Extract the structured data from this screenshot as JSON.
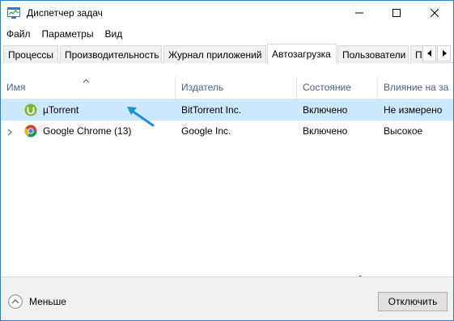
{
  "window": {
    "title": "Диспетчер задач",
    "accent_color": "#1883d7"
  },
  "menu": [
    "Файл",
    "Параметры",
    "Вид"
  ],
  "tabs": [
    {
      "label": "Процессы",
      "active": false
    },
    {
      "label": "Производительность",
      "active": false
    },
    {
      "label": "Журнал приложений",
      "active": false
    },
    {
      "label": "Автозагрузка",
      "active": true
    },
    {
      "label": "Пользователи",
      "active": false
    },
    {
      "label": "По",
      "active": false
    }
  ],
  "table": {
    "sort_column": "name",
    "sort_direction": "ascending",
    "columns": {
      "name": "Имя",
      "publisher": "Издатель",
      "state": "Состояние",
      "impact": "Влияние на за"
    },
    "rows": [
      {
        "name": "µTorrent",
        "publisher": "BitTorrent Inc.",
        "state": "Включено",
        "impact": "Не измерено",
        "icon": "utorrent-icon",
        "selected": true,
        "expandable": false
      },
      {
        "name": "Google Chrome (13)",
        "publisher": "Google Inc.",
        "state": "Включено",
        "impact": "Высокое",
        "icon": "chrome-icon",
        "selected": false,
        "expandable": true
      }
    ]
  },
  "footer": {
    "fewer_label": "Меньше",
    "disable_button": "Отключить"
  },
  "colors": {
    "selection": "#cce8ff",
    "header_text": "#4d6082",
    "annotation_arrow": "#1a8fd8"
  }
}
